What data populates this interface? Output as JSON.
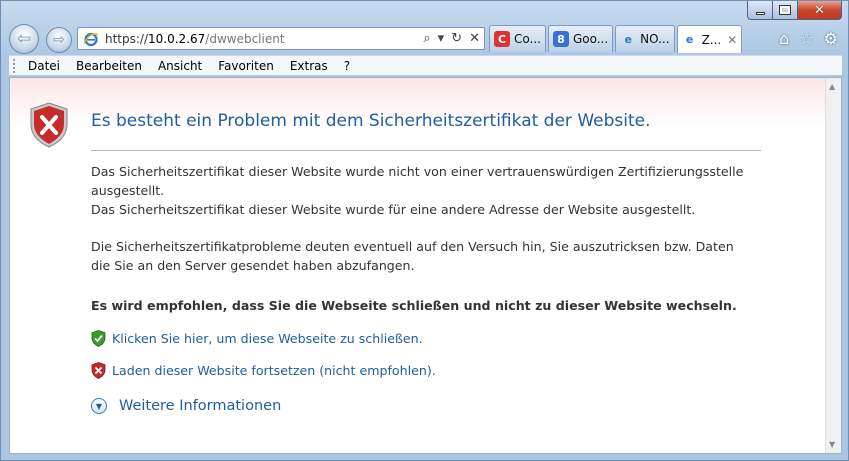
{
  "window": {
    "minimize_glyph": "",
    "close_glyph": "✕"
  },
  "nav": {
    "url_scheme": "https://",
    "url_host": "10.0.2.67",
    "url_path": "/dwwebclient",
    "search_glyph": "⌕",
    "refresh_glyph": "↻",
    "stop_glyph": "✕"
  },
  "tabs": [
    {
      "label": "Co...",
      "icon": "chrome-icon"
    },
    {
      "label": "Goo...",
      "icon": "google-icon",
      "badge": "8"
    },
    {
      "label": "NO...",
      "icon": "ie-icon"
    },
    {
      "label": "Z...",
      "icon": "ie-icon",
      "active": true,
      "close": "✕"
    }
  ],
  "toolbar_icons": {
    "home": "⌂",
    "favorites": "☆",
    "settings": "⚙"
  },
  "menu": [
    "Datei",
    "Bearbeiten",
    "Ansicht",
    "Favoriten",
    "Extras",
    "?"
  ],
  "content": {
    "title": "Es besteht ein Problem mit dem Sicherheitszertifikat der Website.",
    "para1_line1": "Das Sicherheitszertifikat dieser Website wurde nicht von einer vertrauenswürdigen Zertifizierungsstelle ausgestellt.",
    "para1_line2": "Das Sicherheitszertifikat dieser Website wurde für eine andere Adresse der Website ausgestellt.",
    "para2": "Die Sicherheitszertifikatprobleme deuten eventuell auf den Versuch hin, Sie auszutricksen bzw. Daten die Sie an den Server gesendet haben abzufangen.",
    "recommendation": "Es wird empfohlen, dass Sie die Webseite schließen und nicht zu dieser Website wechseln.",
    "link_close": "Klicken Sie hier, um diese Webseite zu schließen.",
    "link_continue": "Laden dieser Website fortsetzen (nicht empfohlen).",
    "more_info": "Weitere Informationen"
  },
  "colors": {
    "link": "#1f5ea0",
    "title": "#1f5ea0",
    "close_button": "#c9462c"
  }
}
